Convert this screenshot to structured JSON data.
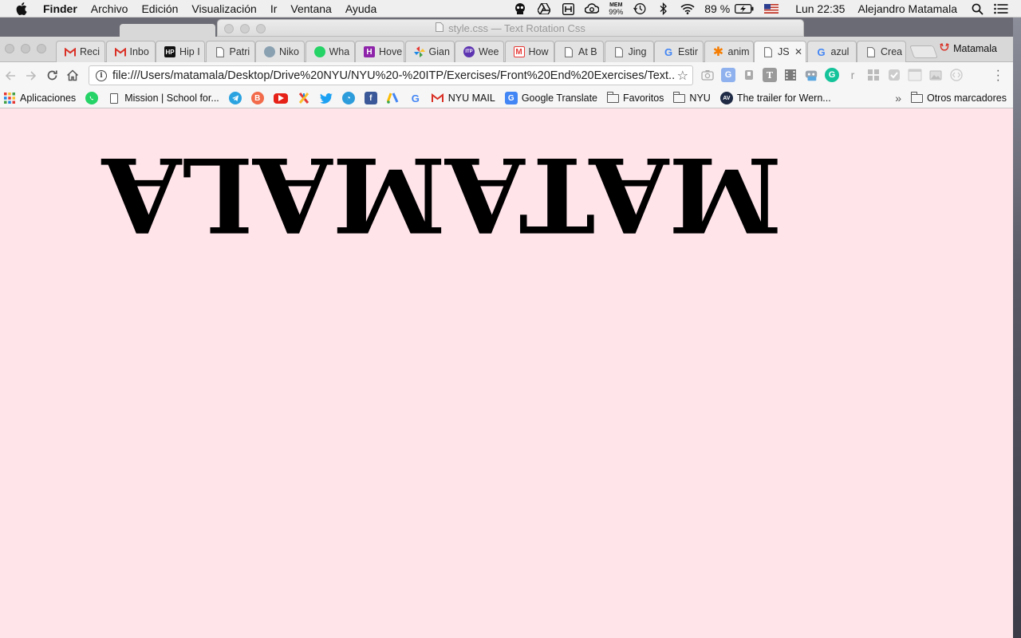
{
  "menubar": {
    "app": "Finder",
    "items": [
      "Archivo",
      "Edición",
      "Visualización",
      "Ir",
      "Ventana",
      "Ayuda"
    ],
    "mem_label": "MEM",
    "mem_value": "99%",
    "battery": "89 %",
    "clock": "Lun 22:35",
    "user": "Alejandro Matamala"
  },
  "bg_window": {
    "title": "style.css — Text Rotation Css"
  },
  "browser": {
    "tabs": [
      {
        "title": "Reci",
        "icon": "gmail-icon",
        "color": "#d93025"
      },
      {
        "title": "Inbo",
        "icon": "gmail-icon",
        "color": "#d93025"
      },
      {
        "title": "Hip I",
        "icon": "hip-icon",
        "color": "#111111"
      },
      {
        "title": "Patri",
        "icon": "document-icon",
        "color": "#666666"
      },
      {
        "title": "Niko",
        "icon": "globe-icon",
        "color": "#8aa1b1"
      },
      {
        "title": "Wha",
        "icon": "whatsapp-icon",
        "color": "#25d366"
      },
      {
        "title": "Hove",
        "icon": "h-icon",
        "color": "#8e24aa"
      },
      {
        "title": "Gian",
        "icon": "pinwheel-icon",
        "color": "#f4b400"
      },
      {
        "title": "Wee",
        "icon": "itp-icon",
        "color": "#5e35b1"
      },
      {
        "title": "How",
        "icon": "m-icon",
        "color": "#e53935"
      },
      {
        "title": "At B",
        "icon": "document-icon",
        "color": "#666666"
      },
      {
        "title": "Jing",
        "icon": "document-icon",
        "color": "#666666"
      },
      {
        "title": "Estir",
        "icon": "google-icon",
        "color": "#4285f4"
      },
      {
        "title": "anim",
        "icon": "asterisk-icon",
        "color": "#f57c00"
      },
      {
        "title": "JS",
        "icon": "document-icon",
        "color": "#666666",
        "active": true
      },
      {
        "title": "azul",
        "icon": "google-icon",
        "color": "#4285f4"
      },
      {
        "title": "Crea",
        "icon": "document-icon",
        "color": "#666666"
      }
    ],
    "profile_name": "Matamala",
    "url": "file:///Users/matamala/Desktop/Drive%20NYU/NYU%20-%20ITP/Exercises/Front%20End%20Exercises/Text...",
    "bookmarks": {
      "apps": "Aplicaciones",
      "mission": "Mission | School for...",
      "nyu_mail": "NYU MAIL",
      "translate": "Google Translate",
      "favoritos": "Favoritos",
      "nyu": "NYU",
      "trailer": "The trailer for Wern...",
      "more": "»",
      "other": "Otros marcadores"
    }
  },
  "page": {
    "rotated_text": "MATAMALA",
    "background": "#ffe4ea",
    "text_color": "#000000",
    "rotation_degrees": 180
  }
}
